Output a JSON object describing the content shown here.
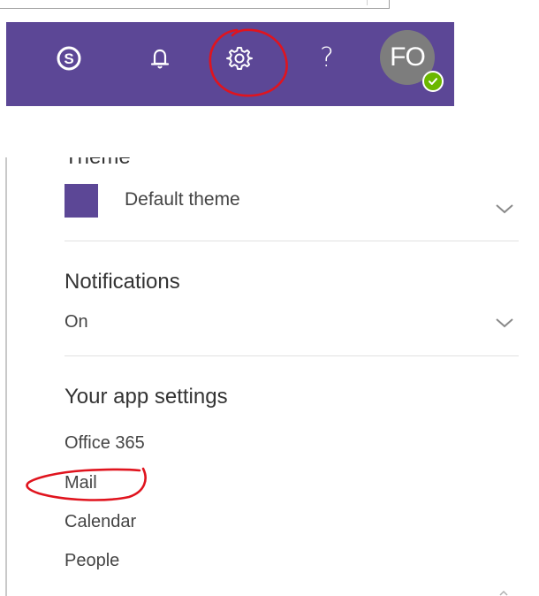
{
  "header": {
    "bar_color": "#5c4796",
    "icons": [
      {
        "name": "skype-icon"
      },
      {
        "name": "bell-icon"
      },
      {
        "name": "gear-icon"
      },
      {
        "name": "help-icon",
        "glyph": "?"
      }
    ],
    "avatar": {
      "initials": "FO",
      "status": "available",
      "status_color": "#6bb700"
    }
  },
  "settings": {
    "theme": {
      "heading": "Theme",
      "value": "Default theme",
      "swatch_color": "#5c4796"
    },
    "notifications": {
      "heading": "Notifications",
      "value": "On"
    },
    "app_settings": {
      "heading": "Your app settings",
      "links": [
        "Office 365",
        "Mail",
        "Calendar",
        "People"
      ]
    }
  },
  "annotations": {
    "color": "#e0141e",
    "circled": [
      "gear-icon",
      "Mail"
    ]
  }
}
